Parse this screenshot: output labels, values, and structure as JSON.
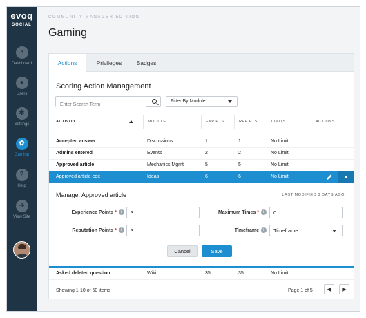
{
  "brand": {
    "name": "evoq",
    "product": "SOCIAL"
  },
  "sidebar": {
    "items": [
      {
        "label": "Dashboard",
        "icon": "dashboard-icon"
      },
      {
        "label": "Users",
        "icon": "users-icon"
      },
      {
        "label": "Settings",
        "icon": "settings-icon"
      },
      {
        "label": "Gaming",
        "icon": "gaming-icon",
        "active": true
      },
      {
        "label": "Help",
        "icon": "help-icon",
        "glyph": "?"
      },
      {
        "label": "View Site",
        "icon": "view-site-icon"
      }
    ]
  },
  "header": {
    "edition": "COMMUNITY MANAGER EDITION",
    "title": "Gaming"
  },
  "tabs": [
    {
      "label": "Actions",
      "active": true
    },
    {
      "label": "Privileges"
    },
    {
      "label": "Badges"
    }
  ],
  "section_title": "Scoring Action Management",
  "search": {
    "placeholder": "Enter Search Term",
    "value": ""
  },
  "filter": {
    "selected": "Filter By Module"
  },
  "table": {
    "columns": [
      "ACTIVITY",
      "MODULE",
      "EXP PTS",
      "REP PTS",
      "LIMITS",
      "ACTIONS"
    ],
    "rows": [
      {
        "activity": "Accepted answer",
        "module": "Discussions",
        "exp": "1",
        "rep": "1",
        "limit": "No Limit"
      },
      {
        "activity": "Admins entered",
        "module": "Events",
        "exp": "2",
        "rep": "2",
        "limit": "No Limit"
      },
      {
        "activity": "Approved article",
        "module": "Mechanics Mgmt",
        "exp": "5",
        "rep": "5",
        "limit": "No Limit"
      },
      {
        "activity": "Approved article edit",
        "module": "Ideas",
        "exp": "6",
        "rep": "6",
        "limit": "No Limit",
        "selected": true
      }
    ],
    "after_rows": [
      {
        "activity": "Asked deleted question",
        "module": "Wiki",
        "exp": "35",
        "rep": "35",
        "limit": "No Limit"
      }
    ]
  },
  "manage": {
    "title": "Manage:  Approved article",
    "last_modified": "LAST MODIFIED 3 DAYS AGO",
    "experience_label": "Experience Points",
    "experience_value": "3",
    "reputation_label": "Reputation Points",
    "reputation_value": "3",
    "max_times_label": "Maximum Times",
    "max_times_value": "0",
    "timeframe_label": "Timeframe",
    "timeframe_value": "Timeframe",
    "required_mark": "*",
    "info_glyph": "i",
    "cancel_label": "Cancel",
    "save_label": "Save"
  },
  "footer": {
    "showing": "Showing 1-10 of 50 items",
    "page_of": "Page 1 of 5",
    "prev": "◀",
    "next": "▶"
  },
  "colors": {
    "accent": "#1d8fd1",
    "sidebar": "#1f3444",
    "required": "#d9342b"
  }
}
